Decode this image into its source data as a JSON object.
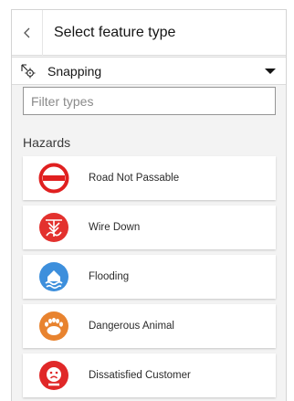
{
  "header": {
    "title": "Select feature type",
    "back_icon": "chevron-left-icon"
  },
  "snapping": {
    "label": "Snapping",
    "icon": "snapping-icon",
    "caret_icon": "caret-down-icon"
  },
  "filter": {
    "placeholder": "Filter types",
    "value": ""
  },
  "group": {
    "title": "Hazards"
  },
  "items": [
    {
      "label": "Road Not Passable",
      "icon": "road-closed-icon",
      "color": "#e02020"
    },
    {
      "label": "Wire Down",
      "icon": "wire-down-icon",
      "color": "#e3312e"
    },
    {
      "label": "Flooding",
      "icon": "flooding-icon",
      "color": "#3d8fdc"
    },
    {
      "label": "Dangerous Animal",
      "icon": "animal-paw-icon",
      "color": "#e8832f"
    },
    {
      "label": "Dissatisfied Customer",
      "icon": "sad-face-icon",
      "color": "#e02828"
    }
  ]
}
